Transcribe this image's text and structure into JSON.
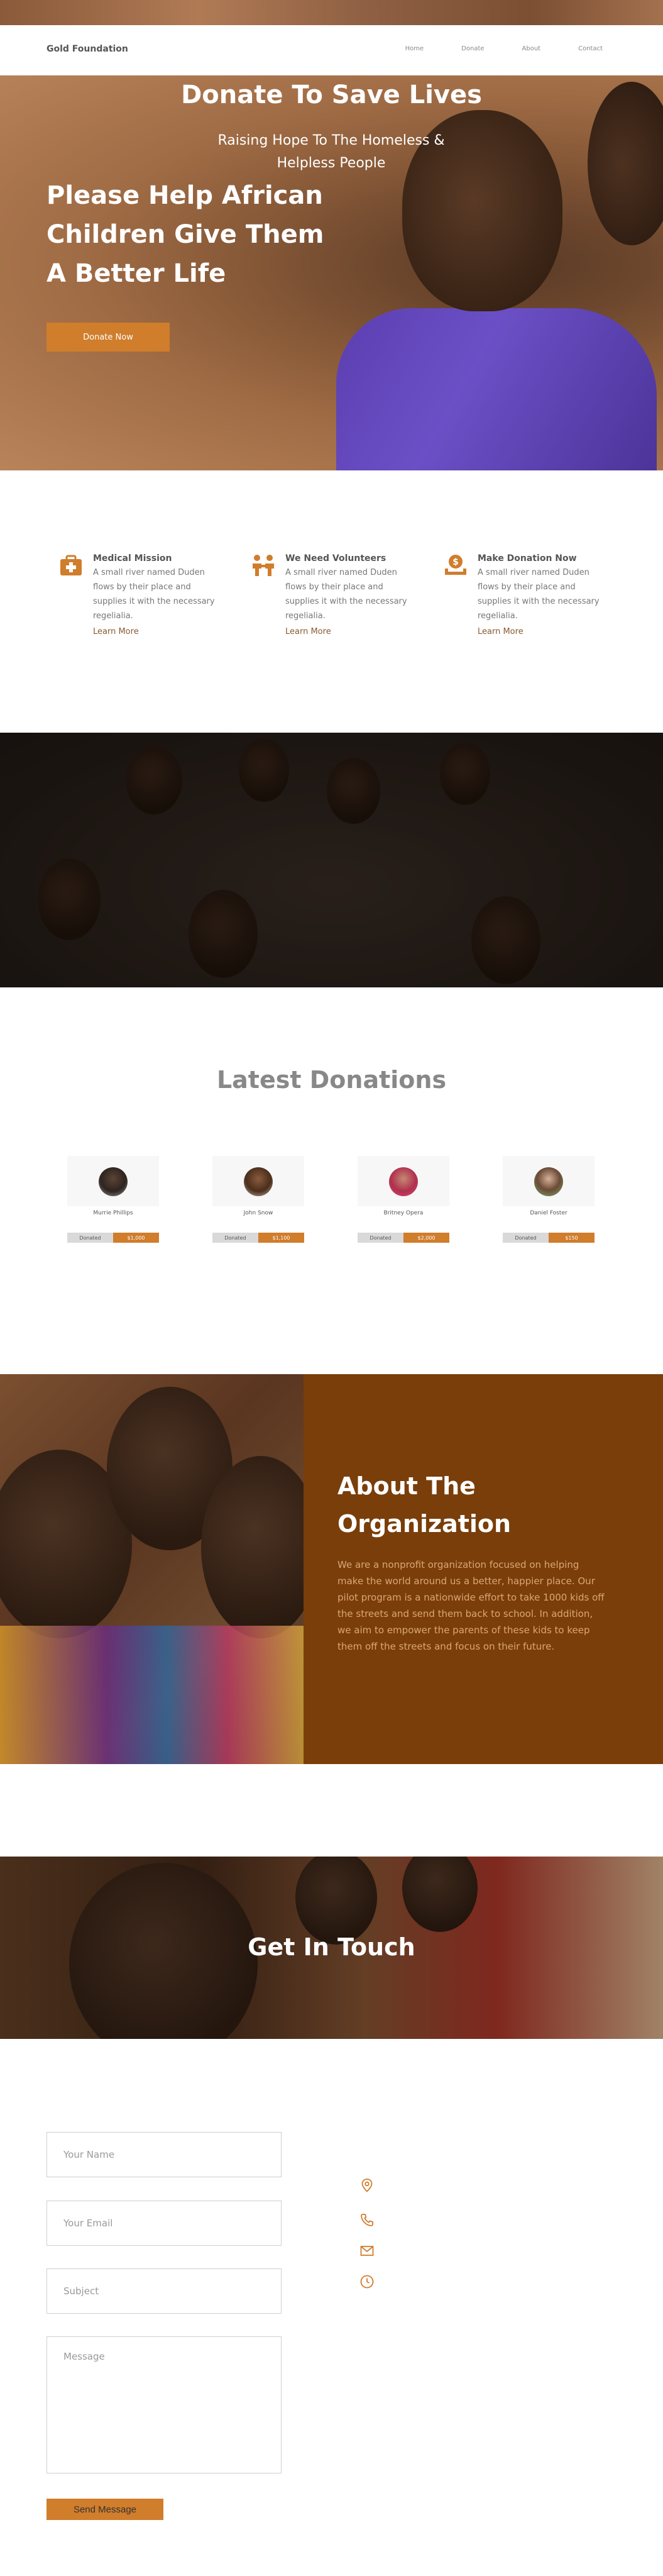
{
  "header": {
    "brand": "Gold Foundation",
    "nav": [
      "Home",
      "Donate",
      "About",
      "Contact"
    ]
  },
  "hero": {
    "title": "Please Help African Children Give Them A Better Life",
    "button": "Donate Now"
  },
  "features": [
    {
      "icon": "medical-kit-icon",
      "title": "Medical Mission",
      "text": "A small river named Duden flows by their place and supplies it with the necessary regelialia.",
      "link": "Learn More"
    },
    {
      "icon": "volunteers-icon",
      "title": "We Need Volunteers",
      "text": "A small river named Duden flows by their place and supplies it with the necessary regelialia.",
      "link": "Learn More"
    },
    {
      "icon": "donation-icon",
      "title": "Make Donation Now",
      "text": "A small river named Duden flows by their place and supplies it with the necessary regelialia.",
      "link": "Learn More"
    }
  ],
  "donate_banner": {
    "title": "Donate To Save Lives",
    "subtitle": "Raising Hope  To The Homeless & Helpless People"
  },
  "latest_donations": {
    "title": "Latest Donations",
    "donors": [
      {
        "name": "Murrie Phillips",
        "label": "Donated",
        "amount": "$1,000"
      },
      {
        "name": "John Snow",
        "label": "Donated",
        "amount": "$1,100"
      },
      {
        "name": "Britney Opera",
        "label": "Donated",
        "amount": "$2,000"
      },
      {
        "name": "Daniel Foster",
        "label": "Donated",
        "amount": "$150"
      }
    ]
  },
  "about": {
    "title": "About The Organization",
    "text": "We are a nonprofit organization focused on helping make the world around us a better, happier place. Our pilot program is a nationwide effort to take 1000 kids off the streets and send them back to school. In addition, we aim to empower the parents of these kids to keep them off the streets and focus on their future."
  },
  "contact": {
    "title": "Get In Touch",
    "name_placeholder": "Your Name",
    "email_placeholder": "Your Email",
    "subject_placeholder": "Subject",
    "message_placeholder": "Message",
    "send": "Send Message",
    "icons": [
      "location-pin-icon",
      "phone-icon",
      "mail-icon",
      "clock-icon"
    ]
  },
  "colors": {
    "accent": "#d07d2c",
    "about_panel": "#7a3e0a"
  }
}
